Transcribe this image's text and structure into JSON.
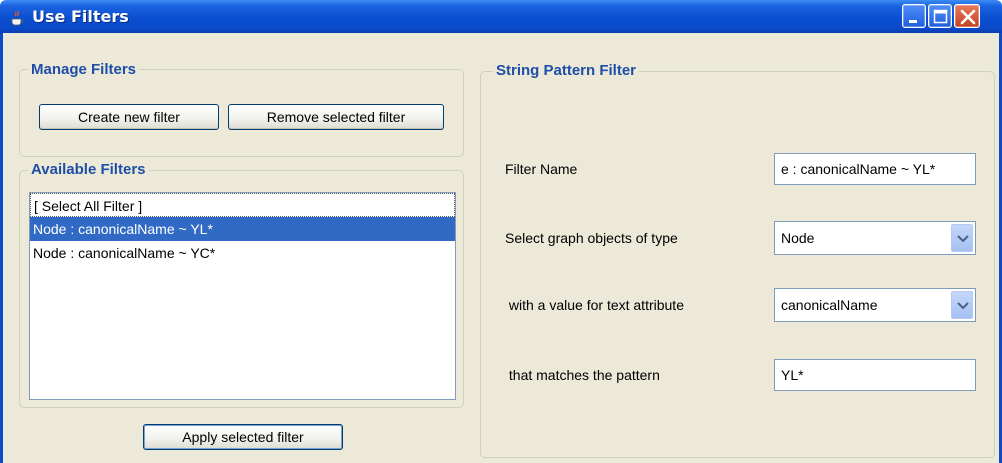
{
  "window": {
    "title": "Use Filters"
  },
  "manage": {
    "title": "Manage Filters",
    "create_label": "Create new filter",
    "remove_label": "Remove selected filter"
  },
  "available": {
    "title": "Available Filters",
    "items": [
      {
        "label": "[ Select All Filter ]",
        "selected": false
      },
      {
        "label": "Node : canonicalName ~ YL*",
        "selected": true
      },
      {
        "label": "Node : canonicalName ~ YC*",
        "selected": false
      }
    ],
    "apply_label": "Apply selected filter"
  },
  "pattern": {
    "title": "String Pattern Filter",
    "name_label": "Filter Name",
    "name_value": "e : canonicalName ~ YL*",
    "type_label": "Select graph objects of type",
    "type_value": "Node",
    "attr_label": " with a value for text attribute",
    "attr_value": "canonicalName",
    "match_label": " that matches the pattern",
    "match_value": "YL*"
  },
  "icons": {
    "title_icon": "java-cup-icon",
    "minimize": "minimize-icon",
    "maximize": "maximize-icon",
    "close": "close-icon",
    "dropdown": "chevron-down-icon"
  },
  "colors": {
    "titlebar": "#0b4ac9",
    "group_title": "#1f4ea8",
    "selection": "#316ac5",
    "close_button": "#d4512d"
  }
}
